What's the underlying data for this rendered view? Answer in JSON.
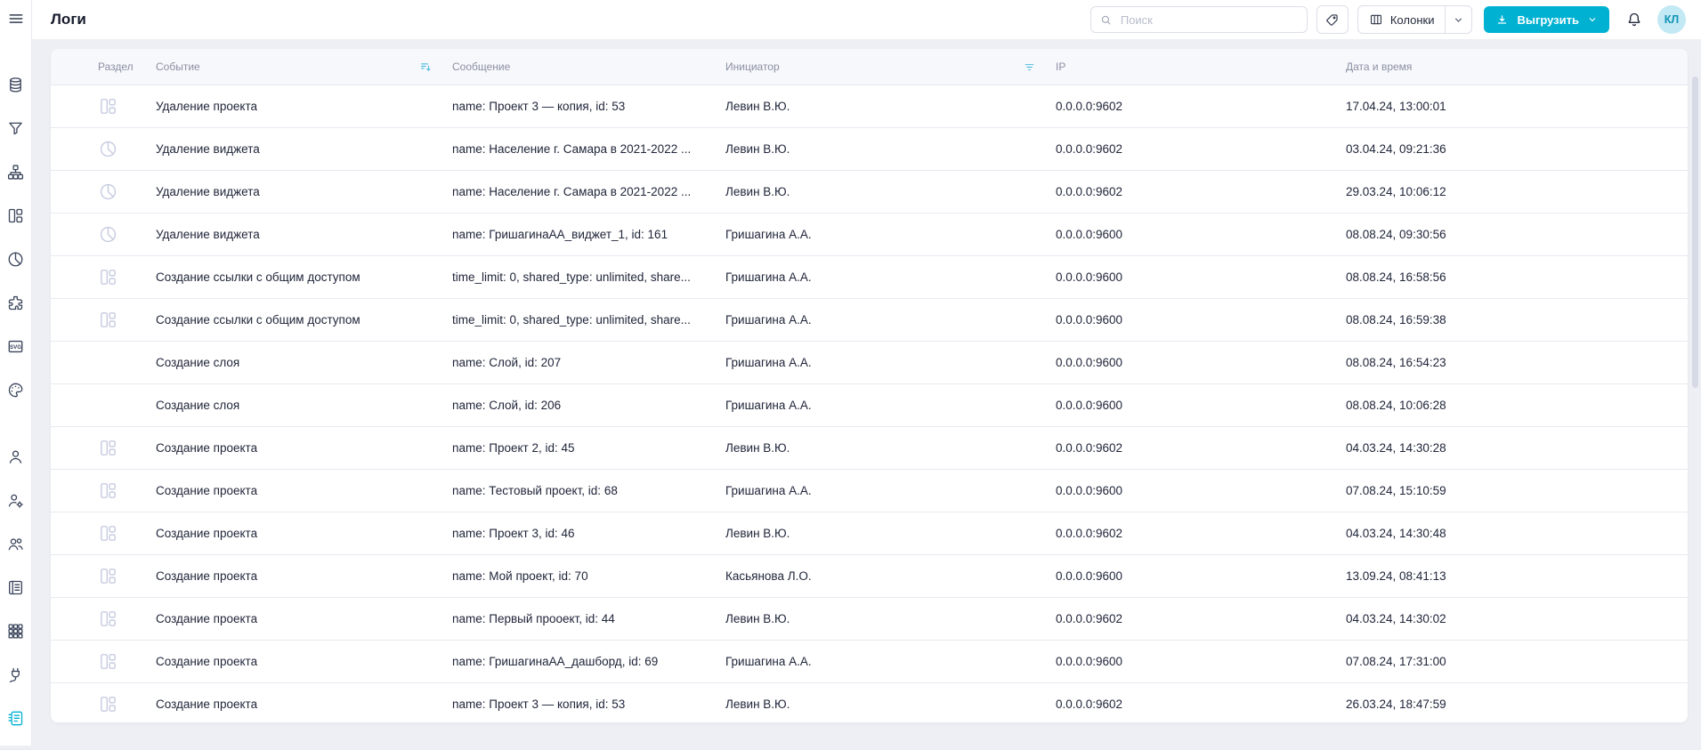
{
  "page": {
    "title": "Логи"
  },
  "topbar": {
    "search": {
      "placeholder": "Поиск",
      "icon": "search-icon"
    },
    "tag_button": {
      "icon": "tag-icon"
    },
    "columns_button": {
      "label": "Колонки",
      "icon": "columns-icon",
      "caret_icon": "chevron-down-icon"
    },
    "export_button": {
      "label": "Выгрузить",
      "icon": "download-icon",
      "caret_icon": "chevron-down-icon"
    },
    "bell": {
      "icon": "bell-icon"
    },
    "avatar": {
      "initials": "КЛ"
    }
  },
  "sidebar": {
    "menu_icon": "menu-icon",
    "groups": [
      {
        "items": [
          "database",
          "filter",
          "sitemap",
          "dashboard",
          "pie-chart",
          "puzzle",
          "svg",
          "palette"
        ]
      },
      {
        "items": [
          "user",
          "user-settings",
          "users-group",
          "book",
          "apps-grid",
          "plug",
          "logs"
        ]
      }
    ],
    "active_item": "logs"
  },
  "table": {
    "columns": [
      {
        "label": "Раздел"
      },
      {
        "label": "Событие",
        "icon": "sort-descending-icon"
      },
      {
        "label": "Сообщение"
      },
      {
        "label": "Инициатор",
        "icon": "filter-icon"
      },
      {
        "label": "IP"
      },
      {
        "label": "Дата и время"
      }
    ],
    "rows": [
      {
        "section_icon": "dashboard",
        "event": "Удаление проекта",
        "message": "name: Проект 3 — копия, id: 53",
        "initiator": "Левин В.Ю.",
        "ip": "0.0.0.0:9602",
        "datetime": "17.04.24, 13:00:01"
      },
      {
        "section_icon": "pie-chart",
        "event": "Удаление виджета",
        "message": "name: Население г. Самара в 2021-2022 ...",
        "initiator": "Левин В.Ю.",
        "ip": "0.0.0.0:9602",
        "datetime": "03.04.24, 09:21:36"
      },
      {
        "section_icon": "pie-chart",
        "event": "Удаление виджета",
        "message": "name: Население г. Самара в 2021-2022 ...",
        "initiator": "Левин В.Ю.",
        "ip": "0.0.0.0:9602",
        "datetime": "29.03.24, 10:06:12"
      },
      {
        "section_icon": "pie-chart",
        "event": "Удаление виджета",
        "message": "name: ГришагинаАА_виджет_1, id: 161",
        "initiator": "Гришагина А.А.",
        "ip": "0.0.0.0:9600",
        "datetime": "08.08.24, 09:30:56"
      },
      {
        "section_icon": "dashboard",
        "event": "Создание ссылки с общим доступом",
        "message": "time_limit: 0, shared_type: unlimited, share...",
        "initiator": "Гришагина А.А.",
        "ip": "0.0.0.0:9600",
        "datetime": "08.08.24, 16:58:56"
      },
      {
        "section_icon": "dashboard",
        "event": "Создание ссылки с общим доступом",
        "message": "time_limit: 0, shared_type: unlimited, share...",
        "initiator": "Гришагина А.А.",
        "ip": "0.0.0.0:9600",
        "datetime": "08.08.24, 16:59:38"
      },
      {
        "section_icon": "none",
        "event": "Создание слоя",
        "message": "name: Слой, id: 207",
        "initiator": "Гришагина А.А.",
        "ip": "0.0.0.0:9600",
        "datetime": "08.08.24, 16:54:23"
      },
      {
        "section_icon": "none",
        "event": "Создание слоя",
        "message": "name: Слой, id: 206",
        "initiator": "Гришагина А.А.",
        "ip": "0.0.0.0:9600",
        "datetime": "08.08.24, 10:06:28"
      },
      {
        "section_icon": "dashboard",
        "event": "Создание проекта",
        "message": "name: Проект 2, id: 45",
        "initiator": "Левин В.Ю.",
        "ip": "0.0.0.0:9602",
        "datetime": "04.03.24, 14:30:28"
      },
      {
        "section_icon": "dashboard",
        "event": "Создание проекта",
        "message": "name: Тестовый проект, id: 68",
        "initiator": "Гришагина А.А.",
        "ip": "0.0.0.0:9600",
        "datetime": "07.08.24, 15:10:59"
      },
      {
        "section_icon": "dashboard",
        "event": "Создание проекта",
        "message": "name: Проект 3, id: 46",
        "initiator": "Левин В.Ю.",
        "ip": "0.0.0.0:9602",
        "datetime": "04.03.24, 14:30:48"
      },
      {
        "section_icon": "dashboard",
        "event": "Создание проекта",
        "message": "name: Мой проект, id: 70",
        "initiator": "Касьянова Л.О.",
        "ip": "0.0.0.0:9600",
        "datetime": "13.09.24, 08:41:13"
      },
      {
        "section_icon": "dashboard",
        "event": "Создание проекта",
        "message": "name: Первый прооект, id: 44",
        "initiator": "Левин В.Ю.",
        "ip": "0.0.0.0:9602",
        "datetime": "04.03.24, 14:30:02"
      },
      {
        "section_icon": "dashboard",
        "event": "Создание проекта",
        "message": "name: ГришагинаАА_дашборд, id: 69",
        "initiator": "Гришагина А.А.",
        "ip": "0.0.0.0:9600",
        "datetime": "07.08.24, 17:31:00"
      },
      {
        "section_icon": "dashboard",
        "event": "Создание проекта",
        "message": "name: Проект 3 — копия, id: 53",
        "initiator": "Левин В.Ю.",
        "ip": "0.0.0.0:9602",
        "datetime": "26.03.24, 18:47:59"
      }
    ]
  },
  "colors": {
    "accent": "#00b1d2",
    "avatar_bg": "#c3e9f4",
    "avatar_text": "#0f93b5",
    "header_text": "#8a90a3",
    "cell_text": "#20263a",
    "section_icon": "#c7cce0",
    "page_bg": "#edeff4"
  }
}
